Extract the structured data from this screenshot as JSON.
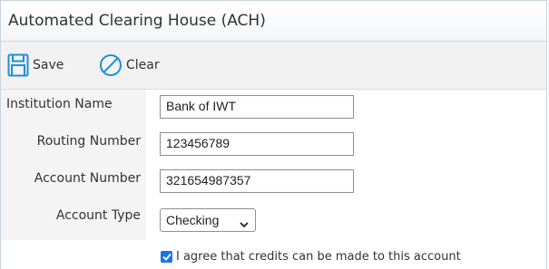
{
  "panel": {
    "title": "Automated Clearing House (ACH)"
  },
  "toolbar": {
    "save_label": "Save",
    "clear_label": "Clear"
  },
  "form": {
    "institution_name": {
      "label": "Institution Name",
      "value": "Bank of IWT"
    },
    "routing_number": {
      "label": "Routing Number",
      "value": "123456789"
    },
    "account_number": {
      "label": "Account Number",
      "value": "321654987357"
    },
    "account_type": {
      "label": "Account Type",
      "selected": "Checking"
    },
    "agree": {
      "label": "I agree that credits can be made to this account",
      "checked": true
    }
  },
  "colors": {
    "accent": "#1a73e8",
    "icon": "#1f8fd6"
  }
}
